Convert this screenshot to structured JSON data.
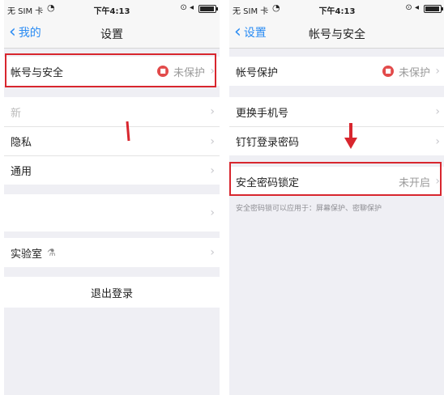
{
  "status_bar": {
    "carrier": "无 SIM 卡",
    "wifi_icon": "wifi-icon",
    "time": "下午4:13",
    "indicators": "⊙ ◂",
    "battery_level": 0.85
  },
  "left": {
    "nav": {
      "back_label": "我的",
      "title": "设置"
    },
    "rows": {
      "account_security": {
        "label": "帐号与安全",
        "value": "未保护"
      },
      "row2": {
        "label": "新"
      },
      "privacy": {
        "label": "隐私"
      },
      "general": {
        "label": "通用"
      },
      "lab": {
        "label": "实验室"
      }
    },
    "logout_label": "退出登录"
  },
  "right": {
    "nav": {
      "back_label": "设置",
      "title": "帐号与安全"
    },
    "rows": {
      "account_protection": {
        "label": "帐号保护",
        "value": "未保护"
      },
      "change_account": {
        "label": "更换手机号"
      },
      "dingtalk_password": {
        "label": "钉钉登录密码"
      },
      "security_lock": {
        "label": "安全密码锁定",
        "value": "未开启"
      }
    },
    "hint": "安全密码锁可以应用于：屏幕保护、密聊保护"
  },
  "colors": {
    "accent": "#2b8cf3",
    "highlight": "#d8262e",
    "lock": "#e24a4a"
  }
}
